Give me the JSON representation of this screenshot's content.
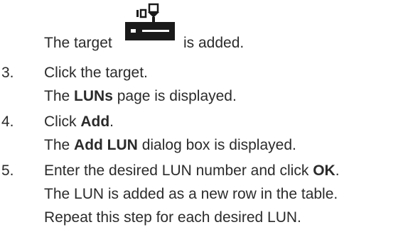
{
  "target_line": {
    "before": "The target",
    "after": "is added.",
    "icon": "storage-target-icon"
  },
  "steps": [
    {
      "number": "3.",
      "action": "Click the target.",
      "result_prefix": "The ",
      "result_bold": "LUNs",
      "result_suffix": " page is displayed."
    },
    {
      "number": "4.",
      "action_prefix": "Click ",
      "action_bold": "Add",
      "action_suffix": ".",
      "result_prefix": "The ",
      "result_bold": "Add LUN",
      "result_suffix": " dialog box is displayed."
    },
    {
      "number": "5.",
      "action_prefix": "Enter the desired LUN number and click ",
      "action_bold": "OK",
      "action_suffix": ".",
      "result": "The LUN is added as a new row in the table.",
      "note": "Repeat this step for each desired LUN."
    }
  ]
}
